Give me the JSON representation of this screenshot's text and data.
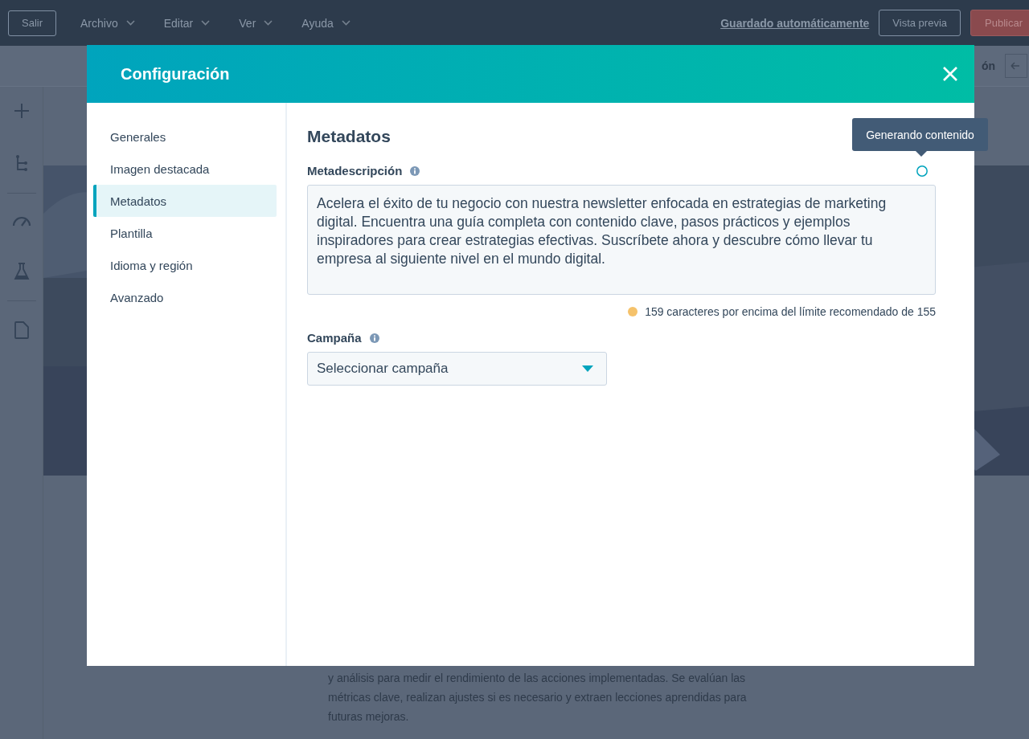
{
  "editor_bar": {
    "exit_button": "Salir",
    "menus": [
      {
        "label": "Archivo"
      },
      {
        "label": "Editar"
      },
      {
        "label": "Ver"
      },
      {
        "label": "Ayuda"
      }
    ],
    "autosave_link": "Guardado automáticamente",
    "preview_button": "Vista previa",
    "publish_button": "Publicar"
  },
  "toolbar": {
    "partial_label": "ón"
  },
  "page_canvas": {
    "paragraph": "y análisis para medir el rendimiento de las acciones implementadas. Se evalúan las métricas clave, realizan ajustes si es necesario y extraen lecciones aprendidas para futuras mejoras."
  },
  "dialog": {
    "title": "Configuración",
    "nav": [
      {
        "label": "Generales",
        "selected": false
      },
      {
        "label": "Imagen destacada",
        "selected": false
      },
      {
        "label": "Metadatos",
        "selected": true
      },
      {
        "label": "Plantilla",
        "selected": false
      },
      {
        "label": "Idioma y región",
        "selected": false
      },
      {
        "label": "Avanzado",
        "selected": false
      }
    ],
    "section_title": "Metadatos",
    "fields": [
      {
        "kind": "textarea",
        "label": "Metadescripción",
        "info": true,
        "generating": true,
        "value": "Acelera el éxito de tu negocio con nuestra newsletter enfocada en estrategias de marketing digital. Encuentra una guía completa con contenido clave, pasos prácticos y ejemplos inspiradores para crear estrategias efectivas. Suscríbete ahora y descubre cómo llevar tu empresa al siguiente nivel en el mundo digital.",
        "warning": "159 caracteres por encima del límite recomendado de 155"
      },
      {
        "kind": "select",
        "label": "Campaña",
        "info": true,
        "placeholder": "Seleccionar campaña"
      }
    ],
    "tooltip": "Generando contenido"
  }
}
